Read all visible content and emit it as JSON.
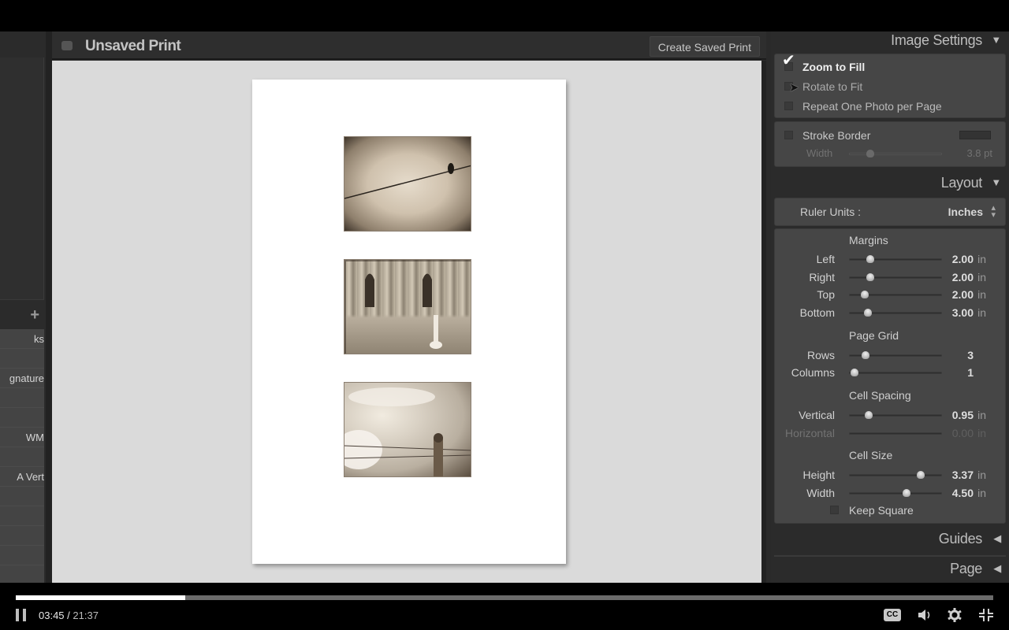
{
  "window": {
    "print_title": "Unsaved Print",
    "create_saved_print_label": "Create Saved Print"
  },
  "left_panel": {
    "add_icon": "plus-icon",
    "items": [
      {
        "label": "ks"
      },
      {
        "label": ""
      },
      {
        "label": "gnature"
      },
      {
        "label": ""
      },
      {
        "label": ""
      },
      {
        "label": "WM"
      },
      {
        "label": ""
      },
      {
        "label": "A Vert"
      },
      {
        "label": ""
      },
      {
        "label": ""
      },
      {
        "label": ""
      },
      {
        "label": ""
      }
    ]
  },
  "canvas": {
    "photos": [
      {
        "name": "bird-on-wire"
      },
      {
        "name": "ruined-church"
      },
      {
        "name": "fence-post-sky"
      }
    ]
  },
  "right_panel": {
    "image_settings": {
      "title": "Image Settings",
      "arrow": "▼",
      "zoom_to_fill": {
        "label": "Zoom to Fill",
        "checked": true
      },
      "rotate_to_fit": {
        "label": "Rotate to Fit",
        "checked": false
      },
      "repeat_one_photo": {
        "label": "Repeat One Photo per Page",
        "checked": false
      },
      "stroke_border": {
        "label": "Stroke Border",
        "checked": false,
        "color": "#333333"
      },
      "stroke_width": {
        "label": "Width",
        "value": "3.8 pt",
        "fraction": 0.22
      }
    },
    "layout": {
      "title": "Layout",
      "arrow": "▼",
      "ruler_units_label": "Ruler Units :",
      "ruler_units_value": "Inches",
      "margins": {
        "title": "Margins",
        "rows": [
          {
            "label": "Left",
            "value": "2.00",
            "unit": "in",
            "fraction": 0.22
          },
          {
            "label": "Right",
            "value": "2.00",
            "unit": "in",
            "fraction": 0.22
          },
          {
            "label": "Top",
            "value": "2.00",
            "unit": "in",
            "fraction": 0.16
          },
          {
            "label": "Bottom",
            "value": "3.00",
            "unit": "in",
            "fraction": 0.2
          }
        ]
      },
      "page_grid": {
        "title": "Page Grid",
        "rows": [
          {
            "label": "Rows",
            "value": "3",
            "unit": "",
            "fraction": 0.17
          },
          {
            "label": "Columns",
            "value": "1",
            "unit": "",
            "fraction": 0.05
          }
        ]
      },
      "cell_spacing": {
        "title": "Cell Spacing",
        "rows": [
          {
            "label": "Vertical",
            "value": "0.95",
            "unit": "in",
            "fraction": 0.21,
            "disabled": false
          },
          {
            "label": "Horizontal",
            "value": "0.00",
            "unit": "in",
            "fraction": 0.0,
            "disabled": true
          }
        ]
      },
      "cell_size": {
        "title": "Cell Size",
        "rows": [
          {
            "label": "Height",
            "value": "3.37",
            "unit": "in",
            "fraction": 0.78
          },
          {
            "label": "Width",
            "value": "4.50",
            "unit": "in",
            "fraction": 0.62
          }
        ]
      },
      "keep_square": {
        "label": "Keep Square",
        "checked": false
      }
    },
    "guides": {
      "title": "Guides",
      "arrow": "◀"
    },
    "page": {
      "title": "Page",
      "arrow": "◀"
    }
  },
  "video_player": {
    "current_time": "03:45",
    "separator": " / ",
    "total_time": "21:37",
    "progress_fraction": 0.1735,
    "cc_label": "CC",
    "icons": [
      "pause-icon",
      "cc-icon",
      "volume-icon",
      "settings-gear-icon",
      "exit-fullscreen-icon"
    ]
  }
}
